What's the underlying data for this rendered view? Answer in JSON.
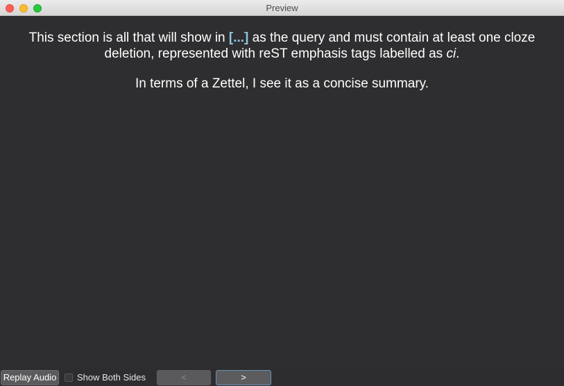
{
  "window": {
    "title": "Preview"
  },
  "content": {
    "para1": {
      "before": "This section is all that will show in ",
      "cloze": "[...]",
      "after": " as the query and must contain at least one cloze deletion, represented with reST emphasis tags labelled as ",
      "emphasis": "ci",
      "end": "."
    },
    "para2": "In terms of a Zettel, I see it as a concise summary.",
    "cloze_color": "#8fc6dd",
    "background_color": "#2e2e30"
  },
  "bottom_bar": {
    "replay_audio_label": "Replay Audio",
    "show_both_sides_label": "Show Both Sides",
    "show_both_sides_checked": false,
    "prev_label": "<",
    "next_label": ">"
  }
}
